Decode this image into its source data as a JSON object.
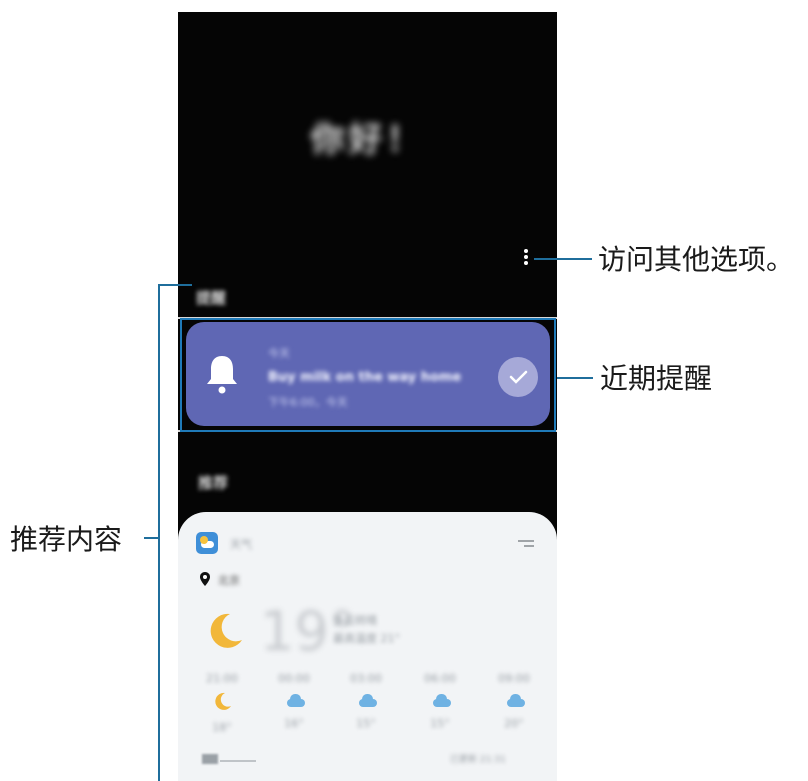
{
  "screen": {
    "greeting": "你好！",
    "reminders_section_label": "提醒",
    "reminder": {
      "small_label": "今天",
      "title": "Buy milk on the way home",
      "time": "下午6:00，今天"
    },
    "recommended_section_label": "推荐",
    "weather": {
      "app_label": "天气",
      "location": "北京",
      "temperature": "19°",
      "condition_line1": "多云转晴",
      "condition_line2": "最高温度 21°",
      "forecast": [
        {
          "time": "21:00",
          "temp": "18°",
          "icon": "moon-icon"
        },
        {
          "time": "00:00",
          "temp": "16°",
          "icon": "cloud-icon"
        },
        {
          "time": "03:00",
          "temp": "15°",
          "icon": "cloud-icon"
        },
        {
          "time": "06:00",
          "temp": "15°",
          "icon": "cloud-icon"
        },
        {
          "time": "09:00",
          "temp": "20°",
          "icon": "cloud-icon"
        }
      ],
      "updated": "已更新 21:31"
    }
  },
  "annotations": {
    "more_options": "访问其他选项。",
    "upcoming_reminder": "近期提醒",
    "recommended_content": "推荐内容"
  },
  "colors": {
    "reminder_card": "#5f67b4",
    "callout_blue": "#1f7ab8",
    "weather_card": "#f2f4f6"
  }
}
